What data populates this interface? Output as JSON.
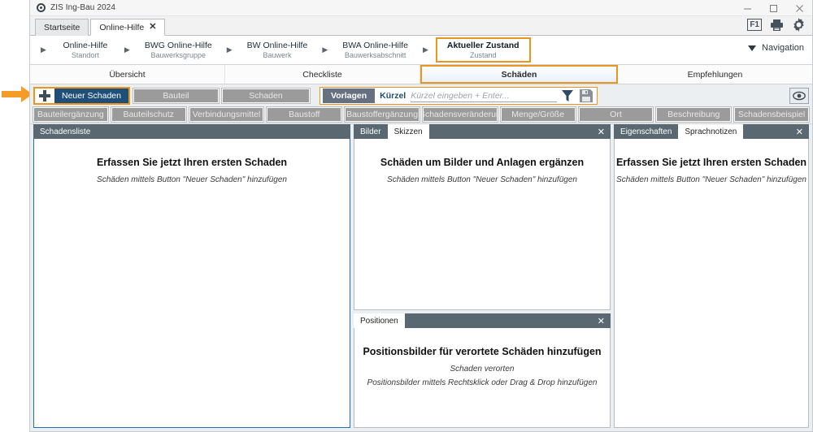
{
  "window": {
    "app_title": "ZIS Ing-Bau 2024",
    "controls": {
      "minimize": "minimize-icon",
      "maximize": "maximize-icon",
      "close": "close-icon"
    }
  },
  "tabs": [
    {
      "label": "Startseite",
      "active": false,
      "closable": false
    },
    {
      "label": "Online-Hilfe",
      "active": true,
      "closable": true,
      "close_glyph": "✕"
    }
  ],
  "breadcrumb": {
    "separator": "▶",
    "items": [
      {
        "title": "Online-Hilfe",
        "subtitle": "Standort",
        "current": false
      },
      {
        "title": "BWG Online-Hilfe",
        "subtitle": "Bauwerksgruppe",
        "current": false
      },
      {
        "title": "BW Online-Hilfe",
        "subtitle": "Bauwerk",
        "current": false
      },
      {
        "title": "BWA Online-Hilfe",
        "subtitle": "Bauwerksabschnitt",
        "current": false
      },
      {
        "title": "Aktueller Zustand",
        "subtitle": "Zustand",
        "current": true
      }
    ]
  },
  "header_icons": {
    "f1_label": "F1",
    "print": "printer-icon",
    "settings": "gear-icon"
  },
  "navigation_button": {
    "label": "Navigation",
    "caret": "chevron-down-icon"
  },
  "section_tabs": [
    {
      "label": "Übersicht",
      "active": false
    },
    {
      "label": "Checkliste",
      "active": false
    },
    {
      "label": "Schäden",
      "active": true
    },
    {
      "label": "Empfehlungen",
      "active": false
    }
  ],
  "toolbar": {
    "new_damage": {
      "label": "Neuer Schaden",
      "plus_icon": "plus-icon",
      "highlighted": true
    },
    "row1_buttons": [
      {
        "label": "Bauteil"
      },
      {
        "label": "Schaden"
      }
    ],
    "templates": {
      "label": "Vorlagen"
    },
    "kuerzel": {
      "label": "Kürzel",
      "value": "",
      "placeholder": "Kürzel eingeben + Enter..."
    },
    "filter_icon": "funnel-icon",
    "save_icon": "floppy-disk-icon",
    "preview_icon": "eye-icon",
    "row2_buttons": [
      {
        "label": "Bauteilergänzung"
      },
      {
        "label": "Bauteilschutz"
      },
      {
        "label": "Verbindungsmittel"
      },
      {
        "label": "Baustoff"
      },
      {
        "label": "Baustoffergänzung"
      },
      {
        "label": "Schadensveränderun"
      },
      {
        "label": "Menge/Größe"
      },
      {
        "label": "Ort"
      },
      {
        "label": "Beschreibung"
      },
      {
        "label": "Schadensbeispiel"
      }
    ]
  },
  "panels": {
    "damage_list": {
      "header": "Schadensliste",
      "empty_title": "Erfassen Sie jetzt Ihren ersten Schaden",
      "empty_subtitle": "Schäden mittels Button \"Neuer Schaden\" hinzufügen"
    },
    "images": {
      "tabs": [
        {
          "label": "Bilder",
          "active": false
        },
        {
          "label": "Skizzen",
          "active": true
        }
      ],
      "close_glyph": "✕",
      "empty_title": "Schäden um Bilder und Anlagen ergänzen",
      "empty_subtitle": "Schäden mittels Button \"Neuer Schaden\" hinzufügen"
    },
    "positions": {
      "tabs": [
        {
          "label": "Positionen",
          "active": true
        }
      ],
      "close_glyph": "✕",
      "empty_title": "Positionsbilder für verortete Schäden hinzufügen",
      "empty_subtitle_1": "Schaden verorten",
      "empty_subtitle_2": "Positionsbilder mittels Rechtsklick oder Drag & Drop hinzufügen"
    },
    "properties": {
      "tabs": [
        {
          "label": "Eigenschaften",
          "active": false
        },
        {
          "label": "Sprachnotizen",
          "active": true
        }
      ],
      "close_glyph": "✕",
      "empty_title": "Erfassen Sie jetzt Ihren ersten Schaden",
      "empty_subtitle": "Schäden mittels Button \"Neuer Schaden\" hinzufügen"
    }
  },
  "colors": {
    "accent_orange": "#E8961E",
    "primary_blue": "#1F4E79",
    "panel_header": "#5A6872",
    "panel_border_blue": "#1F6FB2",
    "button_grey": "#9b9b9b"
  }
}
